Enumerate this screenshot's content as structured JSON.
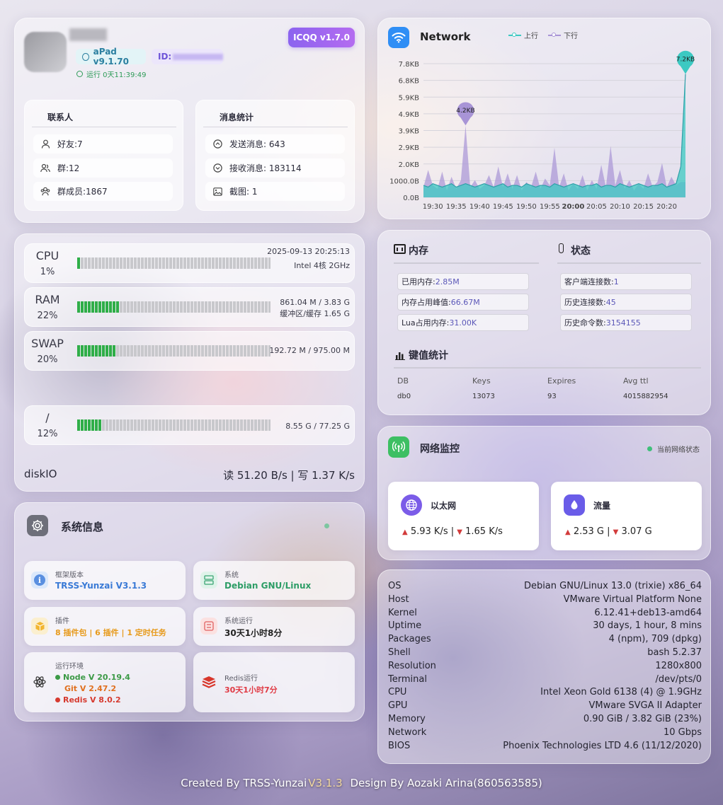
{
  "profile": {
    "version_badge": "ICQQ v1.7.0",
    "platform": "aPad v9.1.70",
    "id_label": "ID:",
    "uptime": "运行 0天11:39:49"
  },
  "contacts": {
    "title": "联系人",
    "items": [
      {
        "label": "好友:7"
      },
      {
        "label": "群:12"
      },
      {
        "label": "群成员:1867"
      }
    ]
  },
  "messages": {
    "title": "消息统计",
    "items": [
      {
        "label": "发送消息: 643"
      },
      {
        "label": "接收消息: 183114"
      },
      {
        "label": "截图: 1"
      }
    ]
  },
  "resources": {
    "cpu": {
      "name": "CPU",
      "percent": "1%",
      "fill": 0.01,
      "info1": "2025-09-13 20:25:13",
      "info2": "Intel 4核 2GHz"
    },
    "ram": {
      "name": "RAM",
      "percent": "22%",
      "fill": 0.22,
      "info1": "861.04 M / 3.83 G",
      "info2": "缓冲区/缓存 1.65 G"
    },
    "swap": {
      "name": "SWAP",
      "percent": "20%",
      "fill": 0.2,
      "info1": "192.72 M / 975.00 M"
    }
  },
  "disk": {
    "name": "/",
    "percent": "12%",
    "fill": 0.12,
    "info": "8.55 G / 77.25 G",
    "io_label": "diskIO",
    "io_value": "读 51.20 B/s | 写 1.37 K/s"
  },
  "sysinfo": {
    "title": "系统信息",
    "cards": {
      "framework": {
        "key": "框架版本",
        "value": "TRSS-Yunzai V3.1.3"
      },
      "system": {
        "key": "系统",
        "value": "Debian GNU/Linux"
      },
      "plugins": {
        "key": "插件",
        "value": "8 插件包 | 6 插件 | 1 定时任务"
      },
      "sys_uptime": {
        "key": "系统运行",
        "value": "30天1小时8分"
      },
      "runtime": {
        "key": "运行环境",
        "node": "Node V 20.19.4",
        "git": "Git V 2.47.2",
        "redis": "Redis V 8.0.2"
      },
      "redis_uptime": {
        "key": "Redis运行",
        "value": "30天1小时7分"
      }
    }
  },
  "network_chart": {
    "title": "Network",
    "legend_up": "上行",
    "legend_down": "下行",
    "colors": {
      "up": "#3cc9c2",
      "down": "#a894d6"
    },
    "peak_down_label": "4.2KB",
    "peak_up_label": "7.2KB"
  },
  "chart_data": {
    "type": "area",
    "title": "Network",
    "xlabel": "",
    "ylabel": "",
    "y_ticks": [
      "7.8KB",
      "6.8KB",
      "5.9KB",
      "4.9KB",
      "3.9KB",
      "2.9KB",
      "2.0KB",
      "1000.0B",
      "0.0B"
    ],
    "x_ticks": [
      "19:30",
      "19:35",
      "19:40",
      "19:45",
      "19:50",
      "19:55",
      "20:00",
      "20:05",
      "20:10",
      "20:15",
      "20:20"
    ],
    "ylim_kb": [
      0,
      7.8
    ],
    "xlim_min": [
      0,
      56
    ],
    "series": [
      {
        "name": "下行",
        "x": [
          0,
          1,
          2,
          3,
          4,
          5,
          6,
          7,
          8,
          9,
          10,
          11,
          12,
          13,
          14,
          15,
          16,
          17,
          18,
          19,
          20,
          21,
          22,
          23,
          24,
          25,
          26,
          27,
          28,
          29,
          30,
          31,
          32,
          33,
          34,
          35,
          36,
          37,
          38,
          39,
          40,
          41,
          42,
          43,
          44,
          45,
          46,
          47,
          48,
          49,
          50,
          51,
          52,
          53,
          54,
          55,
          56
        ],
        "y": [
          0.6,
          1.6,
          0.7,
          0.5,
          1.5,
          0.4,
          1.2,
          0.5,
          1.0,
          4.2,
          0.6,
          1.0,
          0.5,
          0.7,
          1.3,
          0.6,
          1.8,
          0.6,
          1.4,
          0.5,
          1.3,
          0.4,
          0.9,
          0.6,
          1.5,
          0.5,
          1.1,
          0.7,
          2.9,
          0.6,
          1.4,
          0.4,
          0.8,
          0.5,
          1.3,
          0.4,
          1.0,
          0.5,
          1.9,
          0.6,
          3.0,
          0.7,
          1.6,
          0.5,
          1.0,
          0.4,
          0.8,
          0.5,
          1.4,
          0.6,
          0.9,
          2.0,
          0.6,
          1.2,
          0.7,
          0.9,
          0.9
        ]
      },
      {
        "name": "上行",
        "x": [
          0,
          1,
          2,
          3,
          4,
          5,
          6,
          7,
          8,
          9,
          10,
          11,
          12,
          13,
          14,
          15,
          16,
          17,
          18,
          19,
          20,
          21,
          22,
          23,
          24,
          25,
          26,
          27,
          28,
          29,
          30,
          31,
          32,
          33,
          34,
          35,
          36,
          37,
          38,
          39,
          40,
          41,
          42,
          43,
          44,
          45,
          46,
          47,
          48,
          49,
          50,
          51,
          52,
          53,
          54,
          55,
          56
        ],
        "y": [
          0.7,
          0.6,
          0.8,
          0.7,
          0.6,
          0.7,
          0.8,
          0.6,
          0.7,
          0.8,
          0.7,
          0.6,
          0.7,
          0.8,
          0.7,
          0.6,
          0.7,
          0.8,
          0.6,
          0.7,
          0.7,
          0.6,
          0.8,
          0.7,
          0.6,
          0.7,
          0.7,
          0.6,
          0.8,
          0.7,
          0.6,
          0.7,
          0.8,
          0.7,
          0.6,
          0.7,
          0.7,
          0.8,
          0.6,
          0.7,
          0.7,
          0.6,
          0.8,
          0.7,
          0.6,
          0.7,
          0.8,
          0.7,
          0.6,
          0.7,
          0.7,
          0.8,
          0.6,
          0.7,
          0.8,
          1.8,
          7.2
        ]
      }
    ]
  },
  "memory": {
    "title": "内存",
    "items": [
      {
        "key": "已用内存: ",
        "value": "2.85M"
      },
      {
        "key": "内存占用峰值: ",
        "value": "66.67M"
      },
      {
        "key": "Lua占用内存: ",
        "value": "31.00K"
      }
    ]
  },
  "status": {
    "title": "状态",
    "items": [
      {
        "key": "客户端连接数: ",
        "value": "1"
      },
      {
        "key": "历史连接数: ",
        "value": "45"
      },
      {
        "key": "历史命令数: ",
        "value": "3154155"
      }
    ]
  },
  "keyvalue": {
    "title": "键值统计",
    "headers": [
      "DB",
      "Keys",
      "Expires",
      "Avg ttl"
    ],
    "rows": [
      [
        "db0",
        "13073",
        "93",
        "4015882954"
      ]
    ]
  },
  "netmon": {
    "title": "网络监控",
    "current_label": "当前网络状态",
    "ethernet": {
      "title": "以太网",
      "up": "5.93 K/s",
      "sep": "|",
      "down": "1.65 K/s"
    },
    "traffic": {
      "title": "流量",
      "up": "2.53 G",
      "sep": "|",
      "down": "3.07 G"
    }
  },
  "neofetch": [
    {
      "key": "OS",
      "value": "Debian GNU/Linux 13.0 (trixie) x86_64"
    },
    {
      "key": "Host",
      "value": "VMware Virtual Platform None"
    },
    {
      "key": "Kernel",
      "value": "6.12.41+deb13-amd64"
    },
    {
      "key": "Uptime",
      "value": "30 days, 1 hour, 8 mins"
    },
    {
      "key": "Packages",
      "value": "4 (npm), 709 (dpkg)"
    },
    {
      "key": "Shell",
      "value": "bash 5.2.37"
    },
    {
      "key": "Resolution",
      "value": "1280x800"
    },
    {
      "key": "Terminal",
      "value": "/dev/pts/0"
    },
    {
      "key": "CPU",
      "value": "Intel Xeon Gold 6138 (4) @ 1.9GHz"
    },
    {
      "key": "GPU",
      "value": "VMware SVGA II Adapter"
    },
    {
      "key": "Memory",
      "value": "0.90 GiB / 3.82 GiB (23%)"
    },
    {
      "key": "Network",
      "value": "10 Gbps"
    },
    {
      "key": "BIOS",
      "value": "Phoenix Technologies LTD 4.6 (11/12/2020)"
    }
  ],
  "footer": {
    "created": "Created By TRSS-Yunzai",
    "version": "V3.1.3",
    "design": "Design By Aozaki Arina(860563585)"
  }
}
